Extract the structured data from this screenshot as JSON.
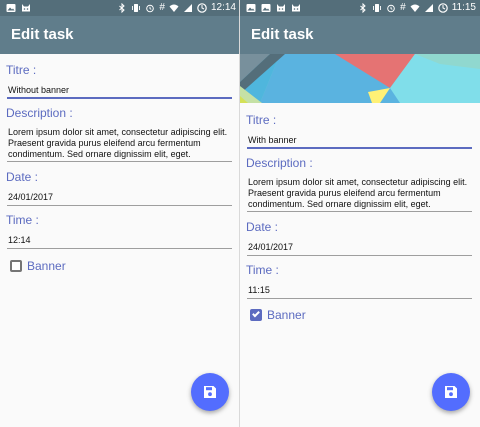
{
  "colors": {
    "status_bar": "#546e7a",
    "app_bar": "#607d8b",
    "accent": "#5c6bc0",
    "fab": "#536dfe"
  },
  "status_bar_icons": [
    "image-icon",
    "cat-icon",
    "image-icon",
    "cat-icon",
    "bluetooth-icon",
    "vibrate-icon",
    "alarm-icon",
    "hash-icon",
    "wifi-icon",
    "signal-icon",
    "battery-icon"
  ],
  "screens": [
    {
      "status_bar": {
        "time": "12:14"
      },
      "app_bar": {
        "title": "Edit task"
      },
      "form": {
        "title_label": "Titre :",
        "title_value": "Without banner",
        "description_label": "Description :",
        "description_value": "Lorem ipsum dolor sit amet, consectetur adipiscing elit. Praesent gravida purus eleifend arcu fermentum condimentum. Sed ornare dignissim elit, eget.",
        "date_label": "Date :",
        "date_value": "24/01/2017",
        "time_label": "Time :",
        "time_value": "12:14",
        "banner_checkbox_label": "Banner",
        "banner_checked": false
      },
      "fab_icon": "save-icon"
    },
    {
      "status_bar": {
        "time": "11:15"
      },
      "app_bar": {
        "title": "Edit task"
      },
      "form": {
        "title_label": "Titre :",
        "title_value": "With banner",
        "description_label": "Description :",
        "description_value": "Lorem ipsum dolor sit amet, consectetur adipiscing elit. Praesent gravida purus eleifend arcu fermentum condimentum. Sed ornare dignissim elit, eget.",
        "date_label": "Date :",
        "date_value": "24/01/2017",
        "time_label": "Time :",
        "time_value": "11:15",
        "banner_checkbox_label": "Banner",
        "banner_checked": true
      },
      "fab_icon": "save-icon"
    }
  ]
}
